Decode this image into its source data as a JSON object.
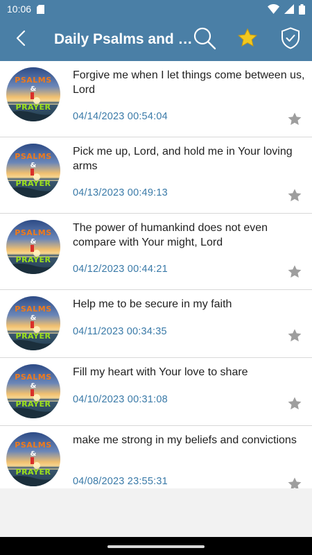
{
  "status_bar": {
    "time": "10:06",
    "icons": [
      "sd-card-icon",
      "wifi-icon",
      "signal-icon",
      "battery-icon"
    ]
  },
  "app_bar": {
    "title": "Daily Psalms and Prayers",
    "icons": [
      "back-icon",
      "search-icon",
      "star-icon",
      "shield-check-icon"
    ],
    "star_color": "#f2c81e",
    "background_color": "#4a7fa6"
  },
  "avatar": {
    "line1": "PSALMS",
    "line2": "&",
    "line3": "PRAYER"
  },
  "prayers": [
    {
      "text": "Forgive me when I let things come between us, Lord",
      "date": "04/14/2023 00:54:04"
    },
    {
      "text": "Pick me up, Lord, and hold me in Your loving arms",
      "date": "04/13/2023 00:49:13"
    },
    {
      "text": "The power of humankind does not even compare with Your might, Lord",
      "date": "04/12/2023 00:44:21"
    },
    {
      "text": "Help me to be secure in my faith",
      "date": "04/11/2023 00:34:35"
    },
    {
      "text": "Fill my heart with Your love to share",
      "date": "04/10/2023 00:31:08"
    },
    {
      "text": "make me strong in my beliefs and convictions",
      "date": "04/08/2023 23:55:31"
    }
  ],
  "colors": {
    "date_text": "#3a7aa8",
    "favorite_star": "#9e9e9e"
  }
}
